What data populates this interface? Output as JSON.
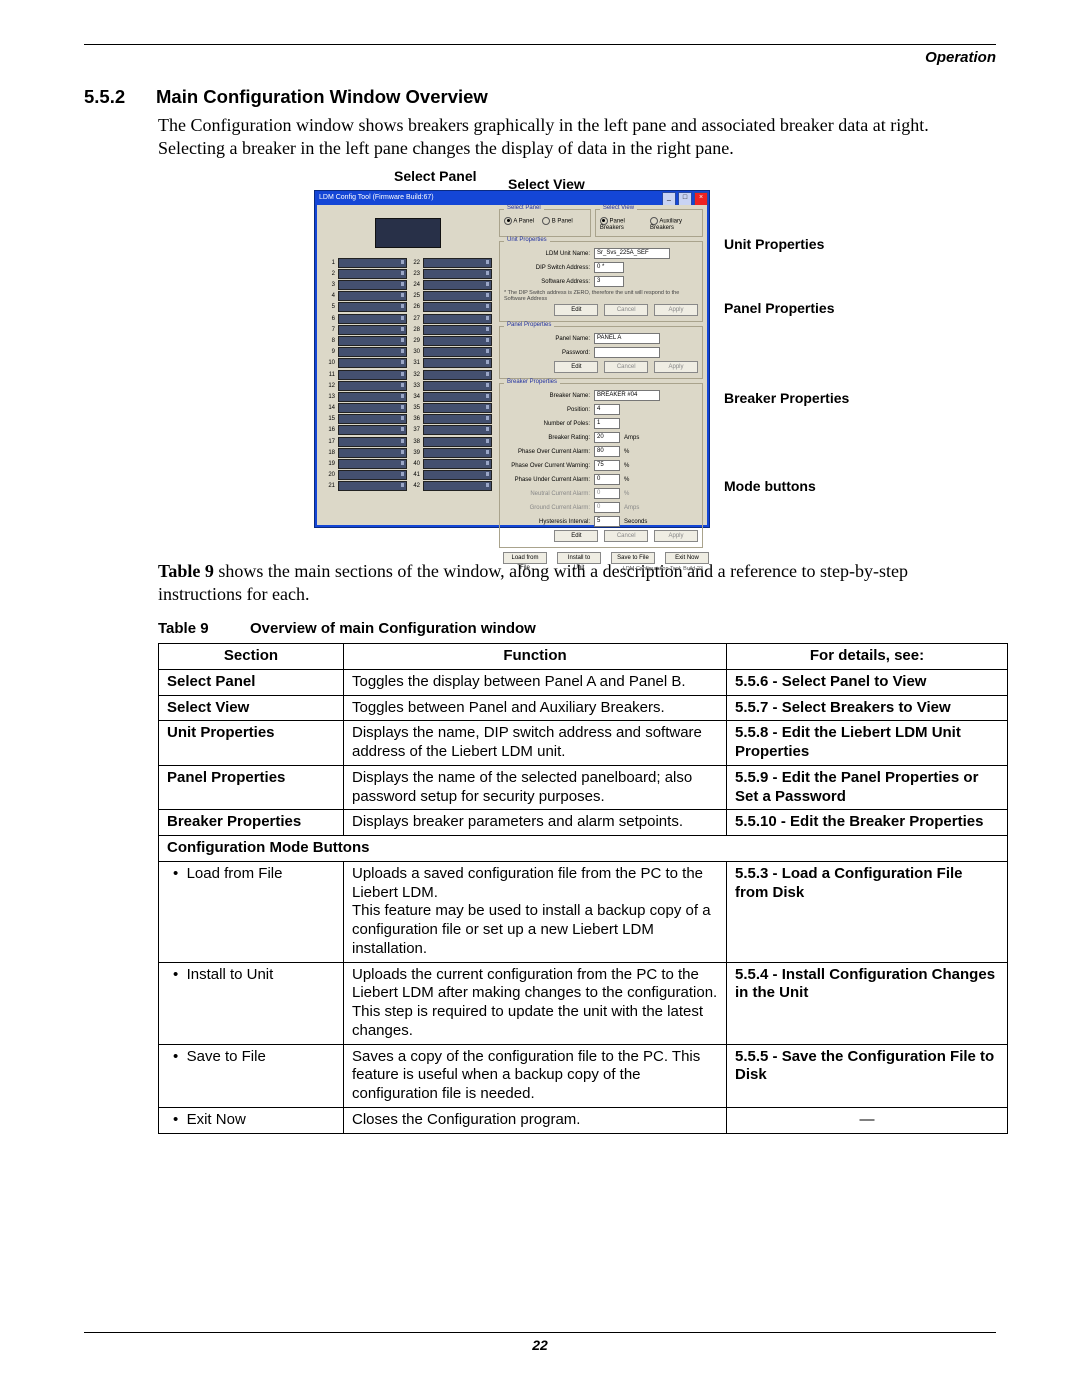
{
  "header": {
    "running": "Operation"
  },
  "section": {
    "number": "5.5.2",
    "title": "Main Configuration Window Overview",
    "para": "The Configuration window shows breakers graphically in the left pane and associated breaker data at right. Selecting a breaker in the left pane changes the display of data in the right pane."
  },
  "diagram_labels": {
    "sel_panel": "Select Panel",
    "sel_view": "Select View",
    "unit": "Unit Properties",
    "panel": "Panel Properties",
    "breaker": "Breaker Properties",
    "mode": "Mode buttons"
  },
  "shot": {
    "title": "LDM Config Tool (Firmware Build:67)",
    "breaker_left": [
      "1",
      "2",
      "3",
      "4",
      "5",
      "6",
      "7",
      "8",
      "9",
      "10",
      "11",
      "12",
      "13",
      "14",
      "15",
      "16",
      "17",
      "18",
      "19",
      "20",
      "21"
    ],
    "breaker_right": [
      "22",
      "23",
      "24",
      "25",
      "26",
      "27",
      "28",
      "29",
      "30",
      "31",
      "32",
      "33",
      "34",
      "35",
      "36",
      "37",
      "38",
      "39",
      "40",
      "41",
      "42"
    ],
    "select_panel": {
      "title": "Select Panel",
      "a": "A Panel",
      "b": "B Panel"
    },
    "select_view": {
      "title": "Select View",
      "pb": "Panel Breakers",
      "ab": "Auxiliary Breakers"
    },
    "unit": {
      "title": "Unit Properties",
      "name_label": "LDM Unit Name:",
      "name": "Sr_Svs_225A_SEF",
      "dip_label": "DIP Switch Address:",
      "dip": "0 *",
      "sw_label": "Software Address:",
      "sw": "3",
      "note": "* The DIP Switch address is ZERO, therefore the unit will respond to the Software Address"
    },
    "panel": {
      "title": "Panel Properties",
      "name_label": "Panel Name:",
      "name": "PANEL A",
      "pwd_label": "Password:",
      "pwd": ""
    },
    "breaker": {
      "title": "Breaker Properties",
      "name_label": "Breaker Name:",
      "name": "BREAKER #04",
      "pos_label": "Position:",
      "pos": "4",
      "poles_label": "Number of Poles:",
      "poles": "1",
      "rating_label": "Breaker Rating:",
      "rating": "20",
      "rating_unit": "Amps",
      "ova_label": "Phase Over Current Alarm:",
      "ova": "80",
      "ova_unit": "%",
      "ovw_label": "Phase Over Current Warning:",
      "ovw": "75",
      "ovw_unit": "%",
      "uca_label": "Phase Under Current Alarm:",
      "uca": "0",
      "uca_unit": "%",
      "nca_label": "Neutral Current Alarm:",
      "nca": "0",
      "nca_unit": "%",
      "gca_label": "Ground Current Alarm:",
      "gca": "0",
      "gca_unit": "Amps",
      "hy_label": "Hysteresis Interval:",
      "hy": "5",
      "hy_unit": "Seconds"
    },
    "buttons": {
      "edit": "Edit",
      "cancel": "Cancel",
      "apply": "Apply",
      "load": "Load from File",
      "install": "Install to Unit",
      "save": "Save to File",
      "exit": "Exit Now"
    },
    "footer": "LDM Configuration Tool: Build 23"
  },
  "lead2": "Table 9 shows the main sections of the window, along with a description and a reference to step-by-step instructions for each.",
  "table": {
    "label": "Table 9",
    "caption": "Overview of main Configuration window",
    "head": [
      "Section",
      "Function",
      "For details, see:"
    ],
    "rows": [
      {
        "s": "Select Panel",
        "f": "Toggles the display between Panel A and Panel B.",
        "d": "5.5.6 - Select Panel to View",
        "sb": true,
        "db": true
      },
      {
        "s": "Select View",
        "f": "Toggles between Panel and Auxiliary Breakers.",
        "d": "5.5.7 - Select Breakers to View",
        "sb": true,
        "db": true
      },
      {
        "s": "Unit Properties",
        "f": "Displays the name, DIP switch address and software address of the Liebert LDM unit.",
        "d": "5.5.8 - Edit the Liebert LDM Unit Properties",
        "sb": true,
        "db": true
      },
      {
        "s": "Panel Properties",
        "f": "Displays the name of the selected panelboard; also password setup for security purposes.",
        "d": "5.5.9 - Edit the Panel Properties or Set a Password",
        "sb": true,
        "db": true
      },
      {
        "s": "Breaker Properties",
        "f": "Displays breaker parameters and alarm setpoints.",
        "d": "5.5.10 - Edit the Breaker Properties",
        "sb": true,
        "db": true
      }
    ],
    "subhead": "Configuration Mode Buttons",
    "rows2": [
      {
        "s": "Load from File",
        "f": "Uploads a saved configuration file from the PC to the Liebert LDM.\nThis feature may be used to install a backup copy of a configuration file or set up a new Liebert LDM installation.",
        "d": "5.5.3 - Load a Configuration File from Disk",
        "db": true
      },
      {
        "s": "Install to Unit",
        "f": "Uploads the current configuration from the PC to the Liebert LDM after making changes to the configuration.\nThis step is required to update the unit with the latest changes.",
        "d": "5.5.4 - Install Configuration Changes in the Unit",
        "db": true
      },
      {
        "s": "Save to File",
        "f": "Saves a copy of the configuration file to the PC. This feature is useful when a backup copy of the configuration file is needed.",
        "d": "5.5.5 - Save the Configuration File to Disk",
        "db": true
      },
      {
        "s": "Exit Now",
        "f": "Closes the Configuration program.",
        "d": "—",
        "dc": true
      }
    ]
  },
  "page_number": "22"
}
